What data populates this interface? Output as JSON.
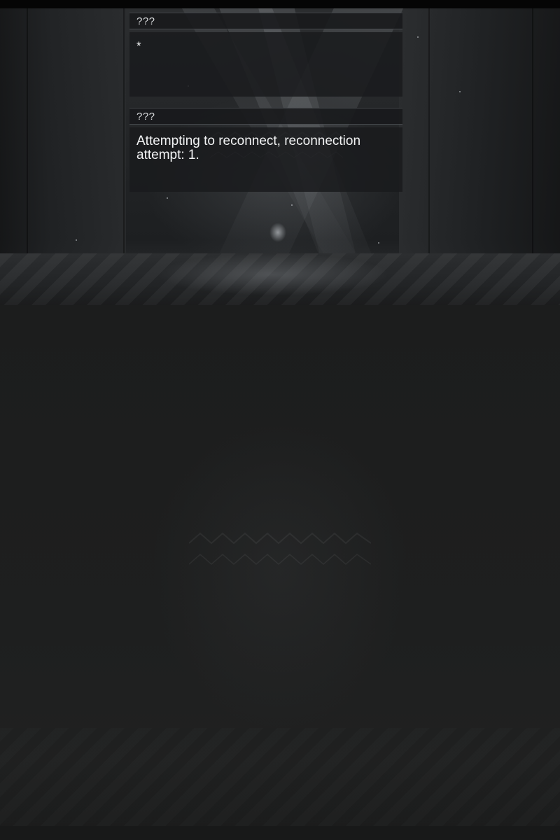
{
  "dialogs": [
    {
      "speaker": "???",
      "message": "*"
    },
    {
      "speaker": "???",
      "message": "Attempting to reconnect, reconnection attempt: 1."
    }
  ],
  "colors": {
    "panel": "#1a1b1d",
    "text": "#f2f3f4",
    "background": "#1b1c1c"
  }
}
